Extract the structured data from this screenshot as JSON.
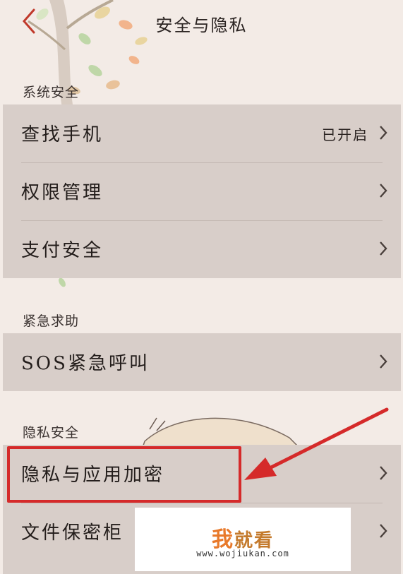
{
  "header": {
    "title": "安全与隐私"
  },
  "sections": [
    {
      "label": "系统安全",
      "items": [
        {
          "label": "查找手机",
          "value": "已开启"
        },
        {
          "label": "权限管理",
          "value": ""
        },
        {
          "label": "支付安全",
          "value": ""
        }
      ]
    },
    {
      "label": "紧急求助",
      "items": [
        {
          "label": "SOS紧急呼叫",
          "value": ""
        }
      ]
    },
    {
      "label": "隐私安全",
      "items": [
        {
          "label": "隐私与应用加密",
          "value": ""
        },
        {
          "label": "文件保密柜",
          "value": ""
        }
      ]
    }
  ],
  "watermark": {
    "brand_first": "我",
    "brand_rest": "就看",
    "url": "www.wojiukan.com"
  },
  "colors": {
    "accent": "#d52a2a",
    "row_bg": "#d8cec9",
    "page_bg": "#f3ebe6"
  }
}
